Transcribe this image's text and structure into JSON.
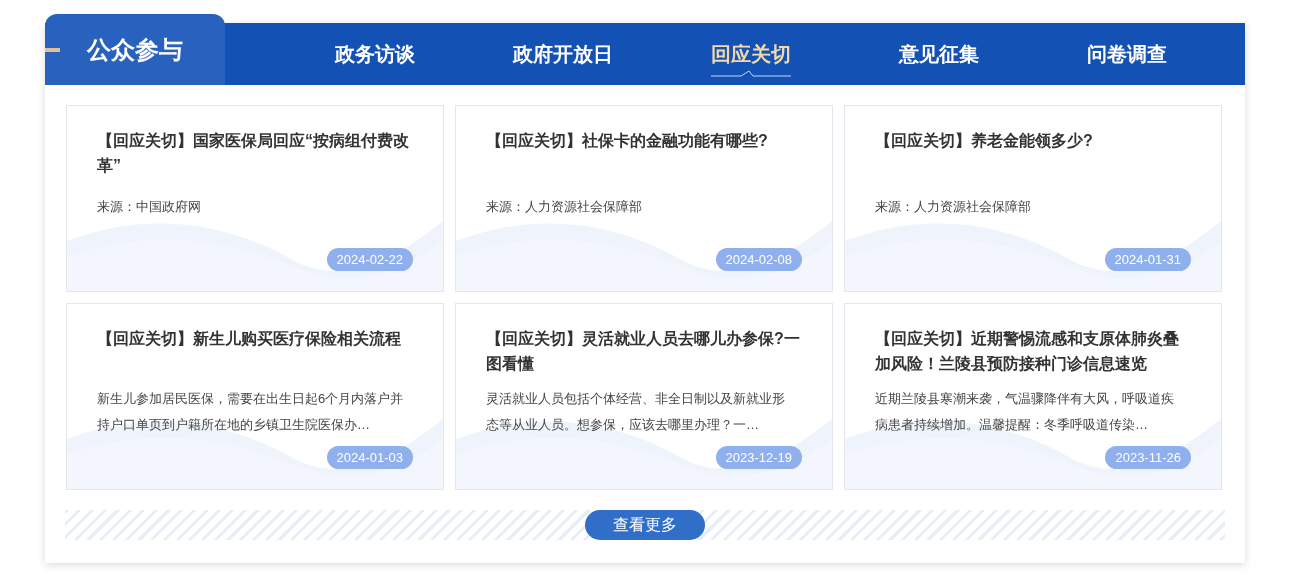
{
  "section_title": "公众参与",
  "tabs": [
    {
      "label": "政务访谈",
      "selected": false
    },
    {
      "label": "政府开放日",
      "selected": false
    },
    {
      "label": "回应关切",
      "selected": true
    },
    {
      "label": "意见征集",
      "selected": false
    },
    {
      "label": "问卷调查",
      "selected": false
    }
  ],
  "cards": [
    {
      "kind": "source",
      "title": "【回应关切】国家医保局回应“按病组付费改革”",
      "text": "来源：中国政府网",
      "date": "2024-02-22"
    },
    {
      "kind": "source",
      "title": "【回应关切】社保卡的金融功能有哪些?",
      "text": "来源：人力资源社会保障部",
      "date": "2024-02-08"
    },
    {
      "kind": "source",
      "title": "【回应关切】养老金能领多少?",
      "text": "来源：人力资源社会保障部",
      "date": "2024-01-31"
    },
    {
      "kind": "summary",
      "title": "【回应关切】新生儿购买医疗保险相关流程",
      "text": "新生儿参加居民医保，需要在出生日起6个月内落户并持户口单页到户籍所在地的乡镇卫生院医保办…",
      "date": "2024-01-03"
    },
    {
      "kind": "summary",
      "title": "【回应关切】灵活就业人员去哪儿办参保?一图看懂",
      "text": "灵活就业人员包括个体经营、非全日制以及新就业形态等从业人员。想参保，应该去哪里办理？一…",
      "date": "2023-12-19"
    },
    {
      "kind": "summary",
      "title": "【回应关切】近期警惕流感和支原体肺炎叠加风险！兰陵县预防接种门诊信息速览",
      "text": "近期兰陵县寒潮来袭，气温骤降伴有大风，呼吸道疾病患者持续增加。温馨提醒：冬季呼吸道传染…",
      "date": "2023-11-26"
    }
  ],
  "more_button": "查看更多"
}
